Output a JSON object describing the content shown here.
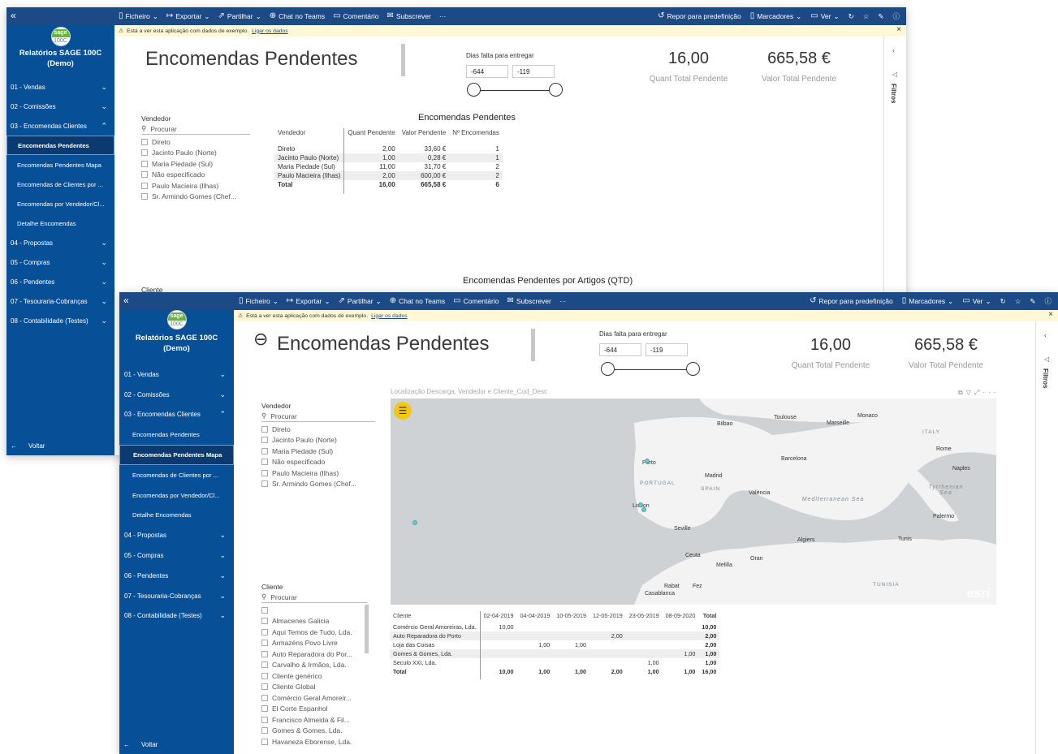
{
  "toolbar": {
    "file": "Ficheiro",
    "export": "Exportar",
    "share": "Partilhar",
    "teams": "Chat no Teams",
    "comment": "Comentário",
    "subscribe": "Subscrever",
    "more": "···",
    "reset": "Repor para predefinição",
    "bookmarks": "Marcadores",
    "view": "Ver"
  },
  "infobar": {
    "message": "Está a ver esta aplicação com dados de exemplo.",
    "link": "Ligar os dados"
  },
  "sidebar": {
    "logo_top": "sage",
    "logo_bottom": "100C",
    "app_title_line1": "Relatórios SAGE 100C",
    "app_title_line2": "(Demo)",
    "items": [
      {
        "label": "01 - Vendas"
      },
      {
        "label": "02 - Comissões"
      },
      {
        "label": "03 - Encomendas Clientes"
      },
      {
        "label": "Encomendas Pendentes"
      },
      {
        "label": "Encomendas Pendentes Mapa"
      },
      {
        "label": "Encomendas de Clientes por ..."
      },
      {
        "label": "Encomendas por Vendedor/Cl..."
      },
      {
        "label": "Detalhe Encomendas"
      },
      {
        "label": "04 - Propostas"
      },
      {
        "label": "05 - Compras"
      },
      {
        "label": "06 - Pendentes"
      },
      {
        "label": "07 - Tesouraria-Cobranças"
      },
      {
        "label": "08 - Contabilidade (Testes)"
      }
    ],
    "back": "Voltar"
  },
  "filters_label": "Filtros",
  "report": {
    "title": "Encomendas Pendentes",
    "range": {
      "label": "Dias falta para entregar",
      "min": "-644",
      "max": "-119"
    },
    "kpi_qty": {
      "value": "16,00",
      "label": "Quant Total Pendente"
    },
    "kpi_value": {
      "value": "665,58 €",
      "label": "Valor Total Pendente"
    },
    "vendor_slicer": {
      "title": "Vendedor",
      "search": "Procurar",
      "items": [
        "Direto",
        "Jacinto Paulo (Norte)",
        "Maria Piedade (Sul)",
        "Não especificado",
        "Paulo Macieira (Ilhas)",
        "Sr. Armindo Gomes (Chef..."
      ]
    },
    "pending_table": {
      "title": "Encomendas Pendentes",
      "headers": [
        "Vendedor",
        "Quant Pendente",
        "Valor Pendente",
        "Nº Encomendas"
      ],
      "rows": [
        [
          "Direto",
          "2,00",
          "33,60 €",
          "1"
        ],
        [
          "Jacinto Paulo (Norte)",
          "1,00",
          "0,28 €",
          "1"
        ],
        [
          "Maria Piedade (Sul)",
          "11,00",
          "31,70 €",
          "2"
        ],
        [
          "Paulo Macieira (Ilhas)",
          "2,00",
          "600,00 €",
          "2"
        ]
      ],
      "total": [
        "Total",
        "16,00",
        "665,58 €",
        "6"
      ]
    },
    "articles_title": "Encomendas Pendentes por Artigos (QTD)",
    "cliente_cut": "Cliente"
  },
  "map_report": {
    "map_title": "Localização Descarga, Vendedor e Cliente_Cod_Desc",
    "map_labels": {
      "bilbao": "Bilbao",
      "toulouse": "Toulouse",
      "marseille": "Marseille",
      "monaco": "Monaco",
      "italy": "ITALY",
      "rome": "Rome",
      "barcelona": "Barcelona",
      "naples": "Naples",
      "porto": "Porto",
      "portugal": "PORTUGAL",
      "madrid": "Madrid",
      "spain": "SPAIN",
      "valencia": "València",
      "tyrrhenian": "Tyrrhenian Sea",
      "med": "Mediterranean Sea",
      "lisbon": "Lisbon",
      "palermo": "Palermo",
      "seville": "Seville",
      "algiers": "Algiers",
      "tunis": "Tunis",
      "ceuta": "Ceuta",
      "oran": "Oran",
      "melilla": "Melilla",
      "rabat": "Rabat",
      "fez": "Fez",
      "casablanca": "Casablanca",
      "tunisia": "TUNISIA",
      "esri": "esri"
    },
    "client_slicer": {
      "title": "Cliente",
      "search": "Procurar",
      "items": [
        "",
        "Almacenes Galicia",
        "Aqui Temos de Tudo, Lda.",
        "Armazéns Povo Livre",
        "Auto Reparadora do Por...",
        "Carvalho & Irmãos, Lda.",
        "Cliente genérico",
        "Cliente Global",
        "Comércio Geral Amoreir...",
        "El Corte Espanhol",
        "Francisco Almeida & Fil...",
        "Gomes & Gomes, Lda.",
        "Havaneza Eborense, Lda."
      ]
    },
    "matrix": {
      "headers": [
        "Cliente",
        "02-04-2019",
        "04-04-2019",
        "10-05-2019",
        "12-05-2019",
        "23-05-2019",
        "08-09-2020",
        "Total"
      ],
      "rows": [
        [
          "Comércio Geral Amoreiras, Lda.",
          "10,00",
          "",
          "",
          "",
          "",
          "",
          "10,00"
        ],
        [
          "Auto Reparadora do Porto",
          "",
          "",
          "",
          "2,00",
          "",
          "",
          "2,00"
        ],
        [
          "Loja das Coisas",
          "",
          "1,00",
          "1,00",
          "",
          "",
          "",
          "2,00"
        ],
        [
          "Gomes & Gomes, Lda.",
          "",
          "",
          "",
          "",
          "",
          "1,00",
          "1,00"
        ],
        [
          "Seculo XXI, Lda.",
          "",
          "",
          "",
          "",
          "1,00",
          "",
          "1,00"
        ]
      ],
      "total": [
        "Total",
        "10,00",
        "1,00",
        "1,00",
        "2,00",
        "1,00",
        "1,00",
        "16,00"
      ]
    }
  }
}
